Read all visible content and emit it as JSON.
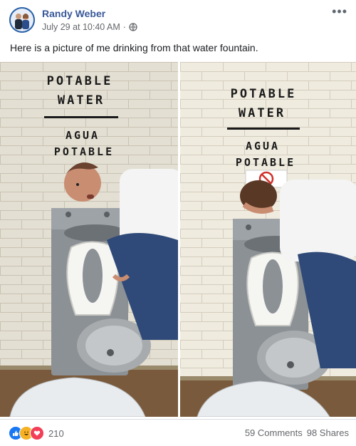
{
  "post": {
    "author": "Randy Weber",
    "timestamp": "July 29 at 10:40 AM",
    "separator": "·",
    "privacy_icon": "globe-icon",
    "more_icon": "more-options-icon",
    "caption": "Here is a picture of me drinking from that water fountain."
  },
  "photos": {
    "left": {
      "sign_line1": "POTABLE",
      "sign_line2": "WATER",
      "sign_line3": "AGUA",
      "sign_line4": "POTABLE"
    },
    "right": {
      "sign_line1": "POTABLE",
      "sign_line2": "WATER",
      "sign_line3": "AGUA",
      "sign_line4": "POTABLE"
    }
  },
  "footer": {
    "reaction_icons": [
      "like-icon",
      "haha-icon",
      "love-icon"
    ],
    "reaction_count": "210",
    "comments": "59 Comments",
    "shares": "98 Shares"
  },
  "colors": {
    "author": "#385898",
    "meta": "#65676b",
    "like": "#1877f2",
    "haha": "#f7b125",
    "love": "#f33e58",
    "wall": "#e9e5d8",
    "steel": "#8a8f94"
  }
}
